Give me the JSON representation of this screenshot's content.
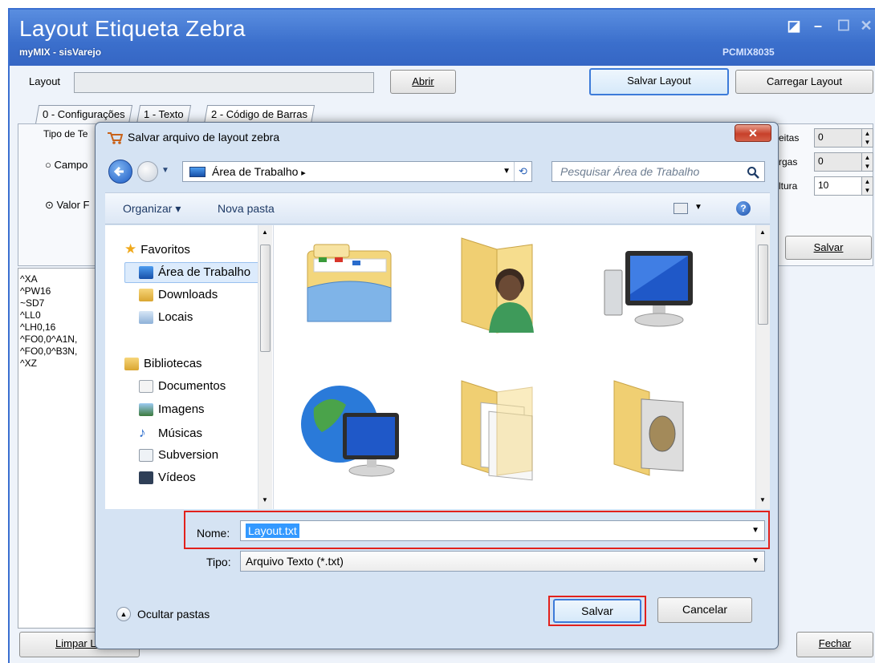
{
  "main": {
    "title": "Layout Etiqueta Zebra",
    "subtitle": "myMIX - sisVarejo",
    "code": "PCMIX8035",
    "layout_label": "Layout",
    "abrir": "Abrir",
    "salvar_layout": "Salvar Layout",
    "carregar_layout": "Carregar Layout",
    "tabs": [
      "0 - Configurações",
      "1 - Texto",
      "2 - Código de Barras"
    ],
    "tipo_label": "Tipo de Te",
    "radio1": "Campo",
    "radio2": "Valor F",
    "right_labels": [
      "eitas",
      "rgas",
      "ltura"
    ],
    "right_values": [
      "0",
      "0",
      "10"
    ],
    "salvar": "Salvar",
    "code_lines": [
      "^XA",
      "^PW16",
      "~SD7",
      "^LL0",
      "^LH0,16",
      "^FO0,0^A1N,",
      "^FO0,0^B3N,",
      "^XZ"
    ],
    "limpar": "Limpar Lis",
    "fechar": "Fechar"
  },
  "dialog": {
    "title": "Salvar arquivo de layout zebra",
    "close": "✕",
    "address": "Área de Trabalho",
    "address_arrow": "▸",
    "search_placeholder": "Pesquisar Área de Trabalho",
    "organizar": "Organizar",
    "nova_pasta": "Nova pasta",
    "nav": {
      "favoritos": "Favoritos",
      "area_trabalho": "Área de Trabalho",
      "downloads": "Downloads",
      "locais": "Locais",
      "bibliotecas": "Bibliotecas",
      "documentos": "Documentos",
      "imagens": "Imagens",
      "musicas": "Músicas",
      "subversion": "Subversion",
      "videos": "Vídeos"
    },
    "nome_label": "Nome:",
    "nome_value": "Layout.txt",
    "tipo_label": "Tipo:",
    "tipo_value": "Arquivo Texto (*.txt)",
    "ocultar": "Ocultar pastas",
    "salvar": "Salvar",
    "cancelar": "Cancelar"
  }
}
